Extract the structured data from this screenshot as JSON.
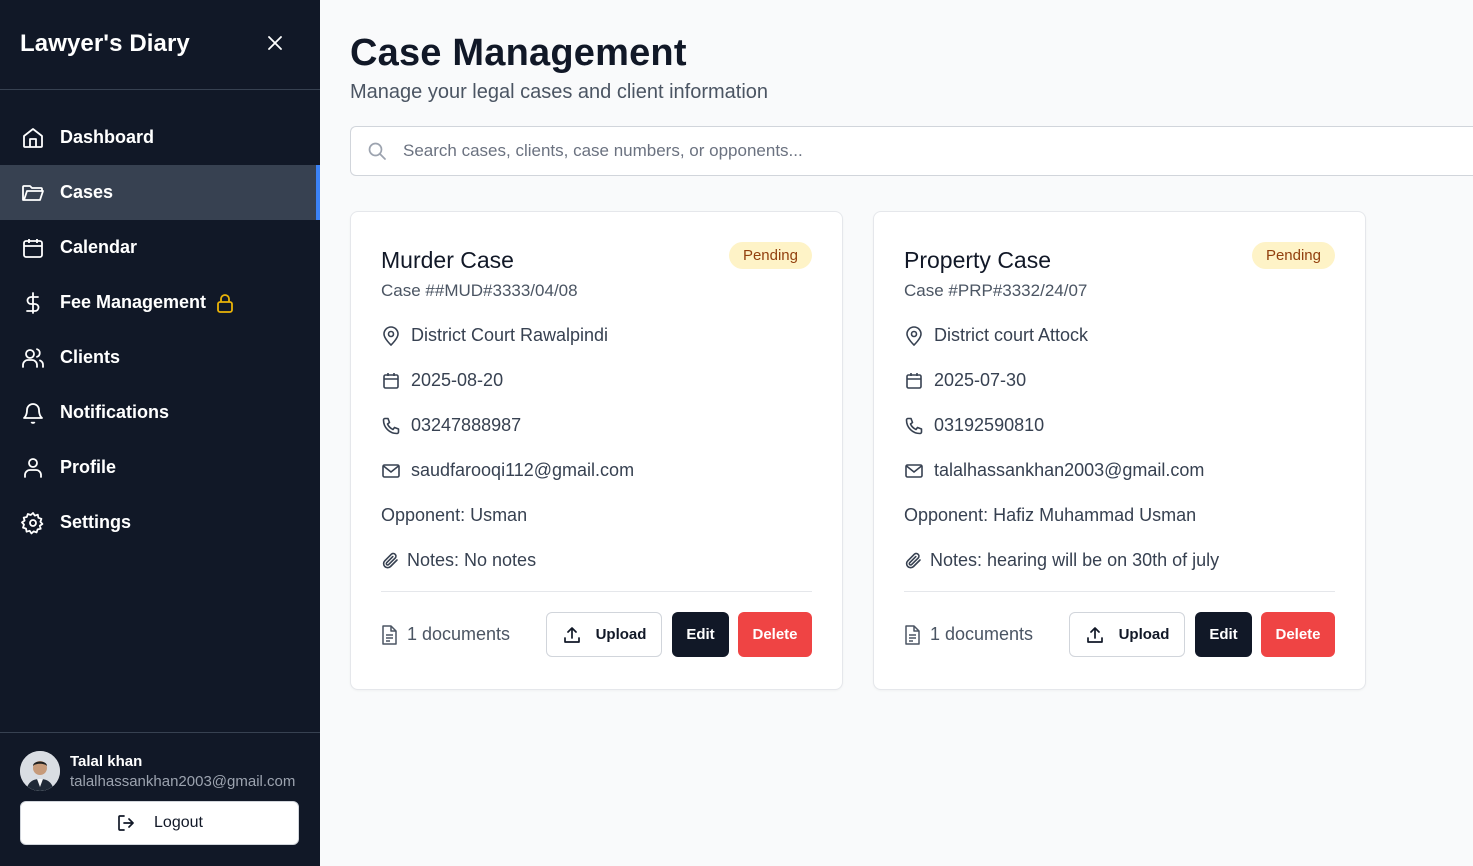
{
  "app": {
    "title": "Lawyer's Diary"
  },
  "sidebar": {
    "items": [
      {
        "label": "Dashboard",
        "icon": "home-icon",
        "active": false
      },
      {
        "label": "Cases",
        "icon": "folder-icon",
        "active": true
      },
      {
        "label": "Calendar",
        "icon": "calendar-icon",
        "active": false
      },
      {
        "label": "Fee Management",
        "icon": "dollar-icon",
        "active": false,
        "locked": true
      },
      {
        "label": "Clients",
        "icon": "users-icon",
        "active": false
      },
      {
        "label": "Notifications",
        "icon": "bell-icon",
        "active": false
      },
      {
        "label": "Profile",
        "icon": "user-icon",
        "active": false
      },
      {
        "label": "Settings",
        "icon": "gear-icon",
        "active": false
      }
    ],
    "user": {
      "name": "Talal khan",
      "email": "talalhassankhan2003@gmail.com"
    },
    "logout_label": "Logout"
  },
  "page": {
    "title": "Case Management",
    "subtitle": "Manage your legal cases and client information"
  },
  "search": {
    "placeholder": "Search cases, clients, case numbers, or opponents...",
    "value": ""
  },
  "cases": [
    {
      "title": "Murder Case",
      "status": "Pending",
      "case_number": "Case ##MUD#3333/04/08",
      "court": "District Court Rawalpindi",
      "date": "2025-08-20",
      "phone": "03247888987",
      "email": "saudfarooqi112@gmail.com",
      "opponent": "Opponent: Usman",
      "notes": "Notes: No notes",
      "documents": "1 documents",
      "upload_label": "Upload",
      "edit_label": "Edit",
      "delete_label": "Delete"
    },
    {
      "title": "Property Case",
      "status": "Pending",
      "case_number": "Case #PRP#3332/24/07",
      "court": "District court Attock",
      "date": "2025-07-30",
      "phone": "03192590810",
      "email": "talalhassankhan2003@gmail.com",
      "opponent": "Opponent: Hafiz Muhammad Usman",
      "notes": "Notes: hearing will be on 30th of july",
      "documents": "1 documents",
      "upload_label": "Upload",
      "edit_label": "Edit",
      "delete_label": "Delete"
    }
  ],
  "colors": {
    "sidebar_bg": "#111827",
    "active_item_bg": "#374151",
    "active_indicator": "#3b82f6",
    "badge_bg": "#fef3c7",
    "badge_text": "#92400e",
    "delete": "#ef4444",
    "lock": "#eab308"
  }
}
